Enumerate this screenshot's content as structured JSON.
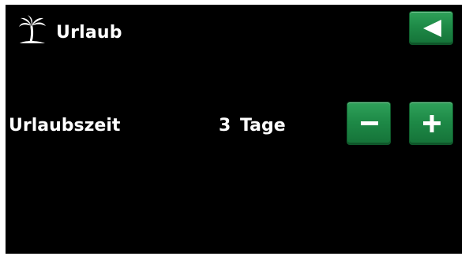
{
  "header": {
    "icon": "palm-tree-icon",
    "title": "Urlaub",
    "back_button_icon": "back-arrow-icon"
  },
  "settings": [
    {
      "label": "Urlaubszeit",
      "value": "3 Tage",
      "decrement_icon": "minus-icon",
      "increment_icon": "plus-icon"
    }
  ],
  "colors": {
    "background": "#000000",
    "text": "#ffffff",
    "button": "#1e8a47"
  }
}
